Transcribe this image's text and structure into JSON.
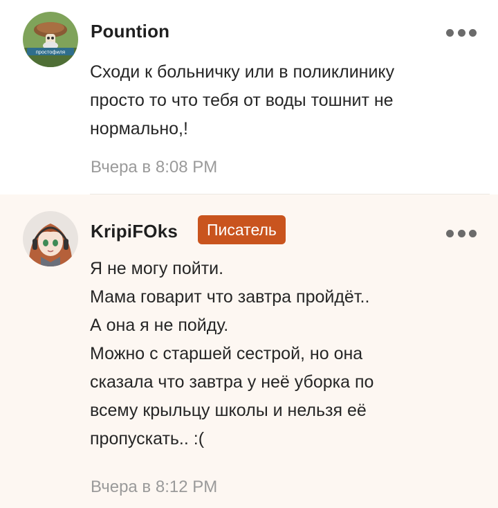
{
  "comments": [
    {
      "author": "Pountion",
      "avatar_caption": "простофиля",
      "lines": [
        "Сходи к больничку или в поликлинику",
        "просто то что тебя от воды тошнит не",
        "нормально,!"
      ],
      "timestamp": "Вчера в 8:08 PM",
      "menu_icon": "more-horizontal-icon"
    },
    {
      "author": "KripiFOks",
      "badge": "Писатель",
      "lines": [
        "Я не могу пойти.",
        "Мама говарит что завтра пройдёт..",
        "А она я не пойду.",
        "Можно с старшей сестрой, но она",
        "сказала что завтра у неё уборка по",
        "всему крыльцу школы и нельзя её",
        "пропускать.. :("
      ],
      "timestamp": "Вчера в 8:12 PM",
      "menu_icon": "more-horizontal-icon"
    }
  ],
  "colors": {
    "badge_bg": "#c9541e",
    "highlight_bg": "#fdf7f2",
    "timestamp": "#9a9a9a"
  }
}
